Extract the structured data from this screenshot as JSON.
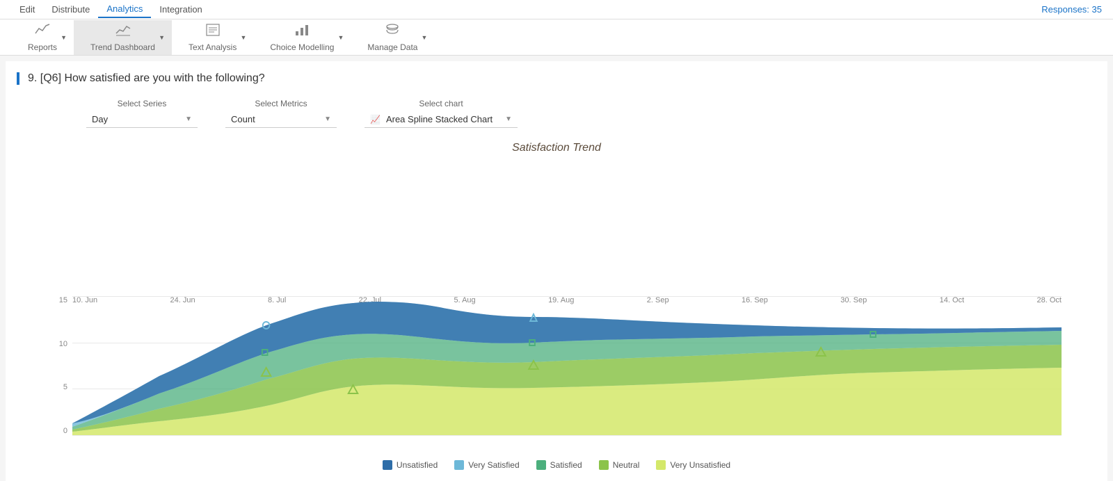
{
  "topNav": {
    "items": [
      {
        "id": "edit",
        "label": "Edit",
        "active": false
      },
      {
        "id": "distribute",
        "label": "Distribute",
        "active": false
      },
      {
        "id": "analytics",
        "label": "Analytics",
        "active": true
      },
      {
        "id": "integration",
        "label": "Integration",
        "active": false
      }
    ],
    "responses": "Responses: 35"
  },
  "subNav": {
    "items": [
      {
        "id": "reports",
        "label": "Reports",
        "active": false,
        "icon": "📈"
      },
      {
        "id": "trend",
        "label": "Trend Dashboard",
        "active": true,
        "icon": "📉"
      },
      {
        "id": "text",
        "label": "Text Analysis",
        "active": false,
        "icon": "▦"
      },
      {
        "id": "choice",
        "label": "Choice Modelling",
        "active": false,
        "icon": "📊"
      },
      {
        "id": "manage",
        "label": "Manage Data",
        "active": false,
        "icon": "🗄"
      }
    ]
  },
  "question": {
    "title": "9. [Q6] How satisfied are you with the following?"
  },
  "controls": {
    "series": {
      "label": "Select Series",
      "value": "Day"
    },
    "metrics": {
      "label": "Select Metrics",
      "value": "Count"
    },
    "chart": {
      "label": "Select chart",
      "value": "Area Spline Stacked Chart"
    }
  },
  "chart": {
    "title": "Satisfaction Trend",
    "yAxis": [
      "15",
      "10",
      "5",
      "0"
    ],
    "xAxis": [
      "10. Jun",
      "24. Jun",
      "8. Jul",
      "22. Jul",
      "5. Aug",
      "19. Aug",
      "2. Sep",
      "16. Sep",
      "30. Sep",
      "14. Oct",
      "28. Oct"
    ]
  },
  "legend": [
    {
      "id": "unsatisfied",
      "label": "Unsatisfied",
      "color": "#2e6da8"
    },
    {
      "id": "very-satisfied",
      "label": "Very Satisfied",
      "color": "#6db8d8"
    },
    {
      "id": "satisfied",
      "label": "Satisfied",
      "color": "#4caf7d"
    },
    {
      "id": "neutral",
      "label": "Neutral",
      "color": "#8bc34a"
    },
    {
      "id": "very-unsatisfied",
      "label": "Very Unsatisfied",
      "color": "#d4e86a"
    }
  ]
}
